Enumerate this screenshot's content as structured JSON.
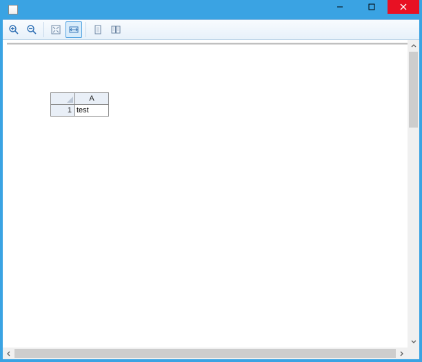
{
  "window": {
    "title": ""
  },
  "sheet": {
    "columns": [
      "A"
    ],
    "rows": [
      {
        "num": "1",
        "cells": [
          "test"
        ]
      }
    ]
  }
}
